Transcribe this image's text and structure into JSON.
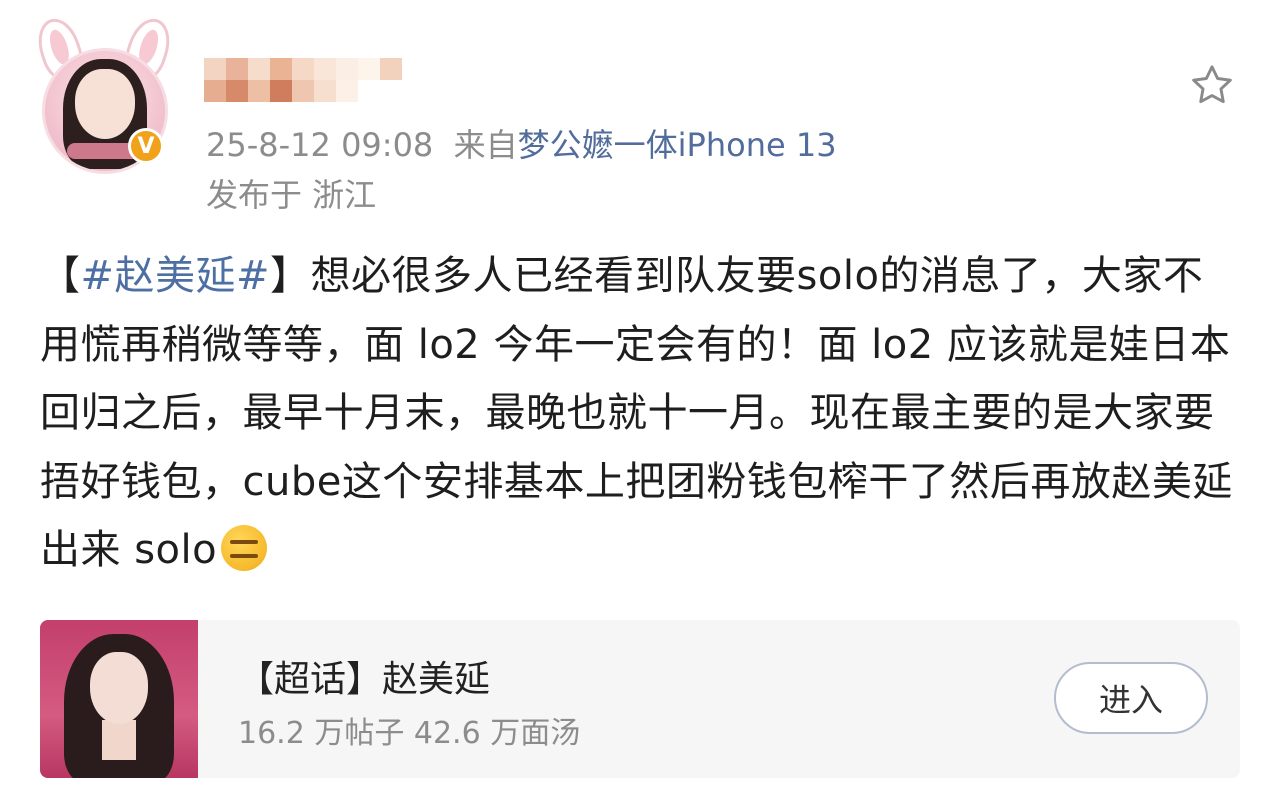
{
  "post": {
    "author": {
      "avatar_icon": "avatar-photo",
      "verified_icon": "verified-v-icon",
      "verified_label": "V",
      "username_blurred": true
    },
    "timestamp": "25-8-12 09:08",
    "source_prefix": "来自",
    "source_name": "梦公嬷一体",
    "source_device": "iPhone 13",
    "location": "发布于 浙江",
    "favorite_icon": "star-outline-icon",
    "text": {
      "bracket_open": "【",
      "hashtag": "#赵美延#",
      "bracket_close": "】",
      "body": "想必很多人已经看到队友要solo的消息了，大家不用慌再稍微等等，面 lo2 今年一定会有的！面 lo2 应该就是娃日本回归之后，最早十月末，最晚也就十一月。现在最主要的是大家要捂好钱包，cube这个安排基本上把团粉钱包榨干了然后再放赵美延出来 solo",
      "emoji": "expressionless-face-emoji"
    }
  },
  "topic_card": {
    "title": "【超话】赵美延",
    "stats": "16.2 万帖子 42.6 万面汤",
    "enter_label": "进入"
  },
  "colors": {
    "hashtag": "#4e6fa3",
    "meta_gray": "#8c8c8c",
    "badge_orange": "#f2a11b",
    "source_orange": "#e0a044"
  }
}
